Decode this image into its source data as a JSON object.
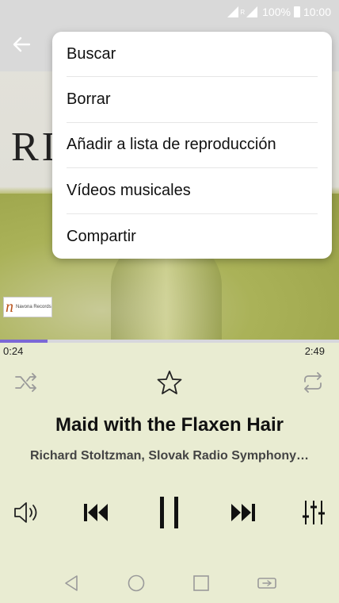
{
  "status_bar": {
    "battery_percent": "100%",
    "time": "10:00",
    "network_label": "R"
  },
  "album_art": {
    "partial_title": "RI",
    "label_logo_letter": "n",
    "label_name": "Navona Records"
  },
  "menu": {
    "items": [
      "Buscar",
      "Borrar",
      "Añadir a lista de reproducción",
      "Vídeos musicales",
      "Compartir"
    ]
  },
  "player": {
    "elapsed": "0:24",
    "duration": "2:49",
    "progress": 0.14,
    "title": "Maid with the Flaxen Hair",
    "artist": "Richard Stoltzman, Slovak Radio Symphony…"
  },
  "icons": {
    "back": "arrow-left-icon",
    "shuffle": "shuffle-icon",
    "favorite": "star-outline-icon",
    "repeat": "repeat-icon",
    "volume": "volume-icon",
    "previous": "skip-previous-icon",
    "pause": "pause-icon",
    "next": "skip-next-icon",
    "equalizer": "equalizer-icon"
  },
  "colors": {
    "accent": "#7b68d6",
    "text_primary": "#111111",
    "text_secondary": "#444444"
  }
}
